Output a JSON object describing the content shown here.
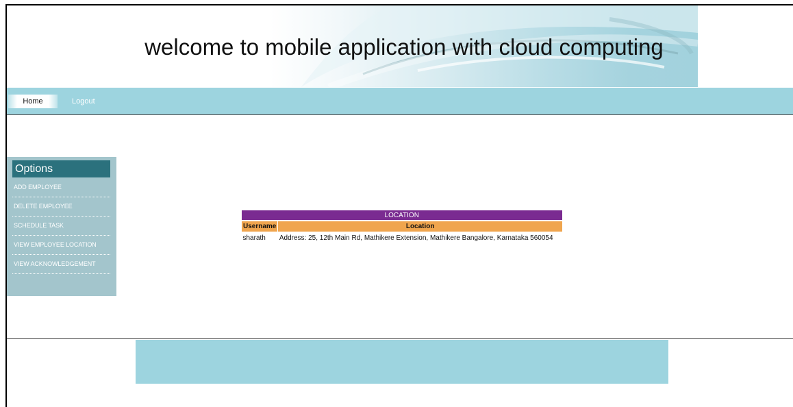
{
  "header": {
    "title": "welcome to mobile application with cloud computing"
  },
  "nav": {
    "home_label": "Home",
    "logout_label": "Logout"
  },
  "sidebar": {
    "heading": "Options",
    "items": [
      {
        "label": "ADD EMPLOYEE"
      },
      {
        "label": "DELETE EMPLOYEE"
      },
      {
        "label": "SCHEDULE TASK"
      },
      {
        "label": "VIEW EMPLOYEE LOCATION"
      },
      {
        "label": "VIEW ACKNOWLEDGEMENT"
      }
    ]
  },
  "location_table": {
    "caption": "LOCATION",
    "columns": [
      "Username",
      "Location"
    ],
    "rows": [
      {
        "username": "sharath",
        "location": "Address: 25, 12th Main Rd, Mathikere Extension, Mathikere Bangalore, Karnataka 560054"
      }
    ]
  },
  "colors": {
    "nav_bg": "#9dd4df",
    "sidebar_bg": "#a3c5cc",
    "sidebar_header": "#2b717d",
    "table_caption": "#7a2b91",
    "table_header": "#f0a54e"
  }
}
